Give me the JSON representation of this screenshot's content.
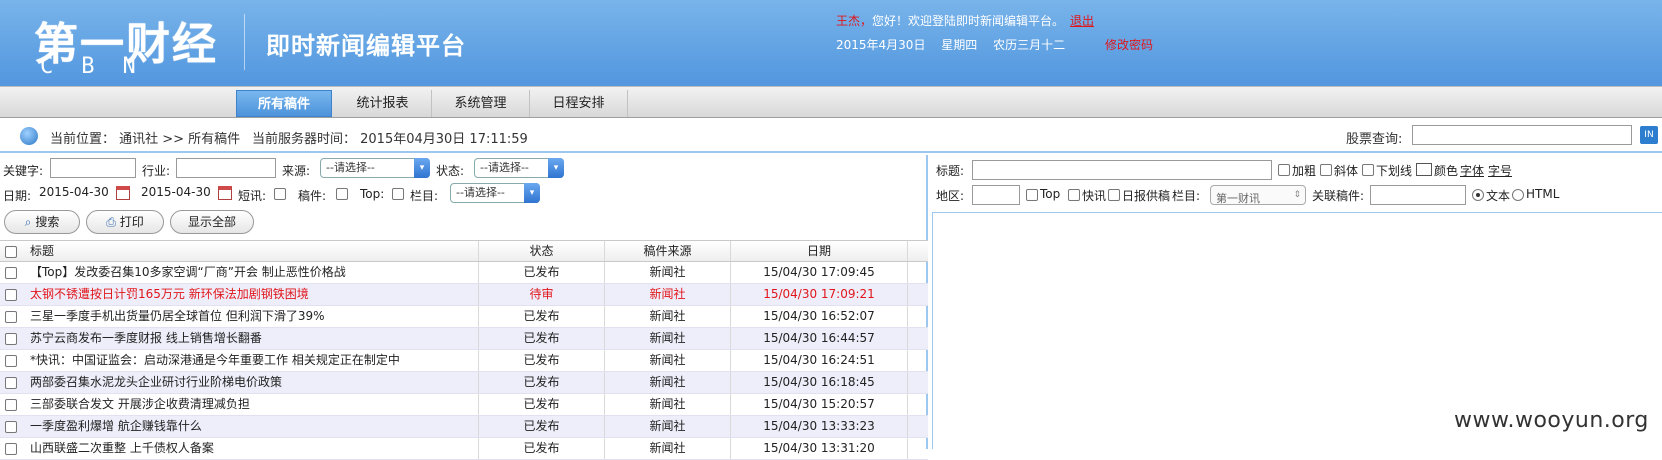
{
  "header": {
    "logo_cn": "第一财经",
    "logo_en": "CBN",
    "platform_title": "即时新闻编辑平台",
    "welcome_user": "王杰，",
    "welcome_text": "您好！欢迎登陆即时新闻编辑平台。",
    "logout_label": "退出",
    "date": "2015年4月30日",
    "weekday": "星期四",
    "lunar": "农历三月十二",
    "change_password_label": "修改密码"
  },
  "nav": {
    "tabs": [
      {
        "label": "所有稿件",
        "active": true
      },
      {
        "label": "统计报表",
        "active": false
      },
      {
        "label": "系统管理",
        "active": false
      },
      {
        "label": "日程安排",
        "active": false
      }
    ]
  },
  "location": {
    "breadcrumb": "当前位置：  通讯社 >> 所有稿件",
    "server_time": "当前服务器时间：  2015年04月30日 17:11:59",
    "stock_label": "股票查询:",
    "stock_value": "",
    "stock_button": "IN"
  },
  "filters": {
    "keyword_label": "关键字:",
    "keyword_value": "",
    "industry_label": "行业:",
    "industry_value": "",
    "source_label": "来源:",
    "source_select": "--请选择--",
    "status_label": "状态:",
    "status_select": "--请选择--",
    "date_label": "日期:",
    "date_from": "2015-04-30",
    "date_to": "2015-04-30",
    "flash_label": "短讯:",
    "draft_label": "稿件:",
    "top_label": "Top:",
    "column_label": "栏目:",
    "column_select": "--请选择--",
    "search_button": "搜索",
    "print_button": "打印",
    "show_all_button": "显示全部"
  },
  "table": {
    "headers": {
      "title": "标题",
      "status": "状态",
      "source": "稿件来源",
      "date": "日期"
    },
    "rows": [
      {
        "title": "【Top】发改委召集10多家空调“厂商”开会 制止恶性价格战",
        "status": "已发布",
        "source": "新闻社",
        "date": "15/04/30 17:09:45",
        "pending": false
      },
      {
        "title": "太钢不锈遭按日计罚165万元 新环保法加剧钢铁困境",
        "status": "待审",
        "source": "新闻社",
        "date": "15/04/30 17:09:21",
        "pending": true
      },
      {
        "title": "三星一季度手机出货量仍居全球首位 但利润下滑了39%",
        "status": "已发布",
        "source": "新闻社",
        "date": "15/04/30 16:52:07",
        "pending": false
      },
      {
        "title": "苏宁云商发布一季度财报 线上销售增长翻番",
        "status": "已发布",
        "source": "新闻社",
        "date": "15/04/30 16:44:57",
        "pending": false
      },
      {
        "title": "*快讯：中国证监会：启动深港通是今年重要工作 相关规定正在制定中",
        "status": "已发布",
        "source": "新闻社",
        "date": "15/04/30 16:24:51",
        "pending": false
      },
      {
        "title": "两部委召集水泥龙头企业研讨行业阶梯电价政策",
        "status": "已发布",
        "source": "新闻社",
        "date": "15/04/30 16:18:45",
        "pending": false
      },
      {
        "title": "三部委联合发文 开展涉企收费清理减负担",
        "status": "已发布",
        "source": "新闻社",
        "date": "15/04/30 15:20:57",
        "pending": false
      },
      {
        "title": "一季度盈利爆增 航企赚钱靠什么",
        "status": "已发布",
        "source": "新闻社",
        "date": "15/04/30 13:33:23",
        "pending": false
      },
      {
        "title": "山西联盛二次重整 上千债权人备案",
        "status": "已发布",
        "source": "新闻社",
        "date": "15/04/30 13:31:20",
        "pending": false
      }
    ]
  },
  "editor": {
    "title_label": "标题:",
    "title_value": "",
    "bold_label": "加粗",
    "italic_label": "斜体",
    "underline_label": "下划线",
    "color_label": "颜色",
    "font_label": "字体",
    "size_label": "字号",
    "region_label": "地区:",
    "region_value": "",
    "top_label": "Top",
    "flash_label": "快讯",
    "daily_label": "日报供稿",
    "column_label": "栏目:",
    "column_select": "第一财讯",
    "related_label": "关联稿件:",
    "related_value": "",
    "text_radio_label": "文本",
    "html_radio_label": "HTML"
  },
  "watermark": "www.wooyun.org"
}
